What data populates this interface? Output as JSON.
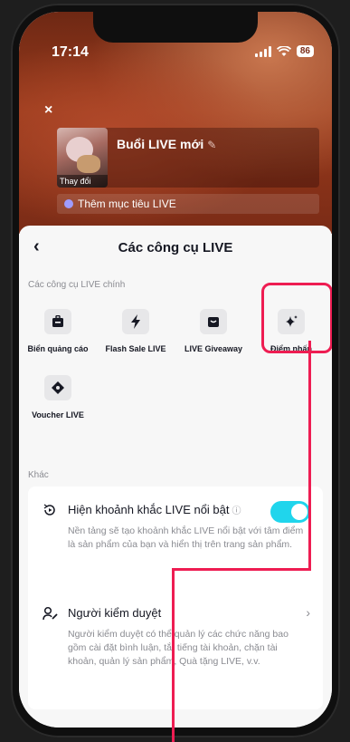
{
  "status_bar": {
    "time": "17:14",
    "battery": "86"
  },
  "live_setup": {
    "close_symbol": "×",
    "thumbnail_label": "Thay đổi",
    "title": "Buổi LIVE mới",
    "goal_label": "Thêm mục tiêu LIVE"
  },
  "sheet": {
    "back_symbol": "‹",
    "title": "Các công cụ LIVE",
    "main_tools_label": "Các công cụ LIVE chính",
    "tools": [
      {
        "label": "Biển quảng cáo",
        "icon": "billboard-icon"
      },
      {
        "label": "Flash Sale LIVE",
        "icon": "lightning-icon"
      },
      {
        "label": "LIVE Giveaway",
        "icon": "gift-bag-icon"
      },
      {
        "label": "Điểm nhấn",
        "icon": "sparkle-icon"
      },
      {
        "label": "Voucher LIVE",
        "icon": "voucher-icon"
      }
    ],
    "other_label": "Khác",
    "other": {
      "highlight_title": "Hiện khoảnh khắc LIVE nổi bật",
      "highlight_desc": "Nền tảng sẽ tạo khoảnh khắc LIVE nổi bật với tâm điểm là sản phẩm của bạn và hiển thị trên trang sản phẩm.",
      "highlight_enabled": true,
      "moderator_title": "Người kiểm duyệt",
      "moderator_desc": "Người kiểm duyệt có thể quản lý các chức năng bao gồm cài đặt bình luận, tắt tiếng tài khoản, chặn tài khoản, quản lý sản phẩm, Quà tặng LIVE, v.v."
    }
  },
  "colors": {
    "accent_pink": "#ee1d52",
    "toggle_on": "#20d5ec"
  }
}
